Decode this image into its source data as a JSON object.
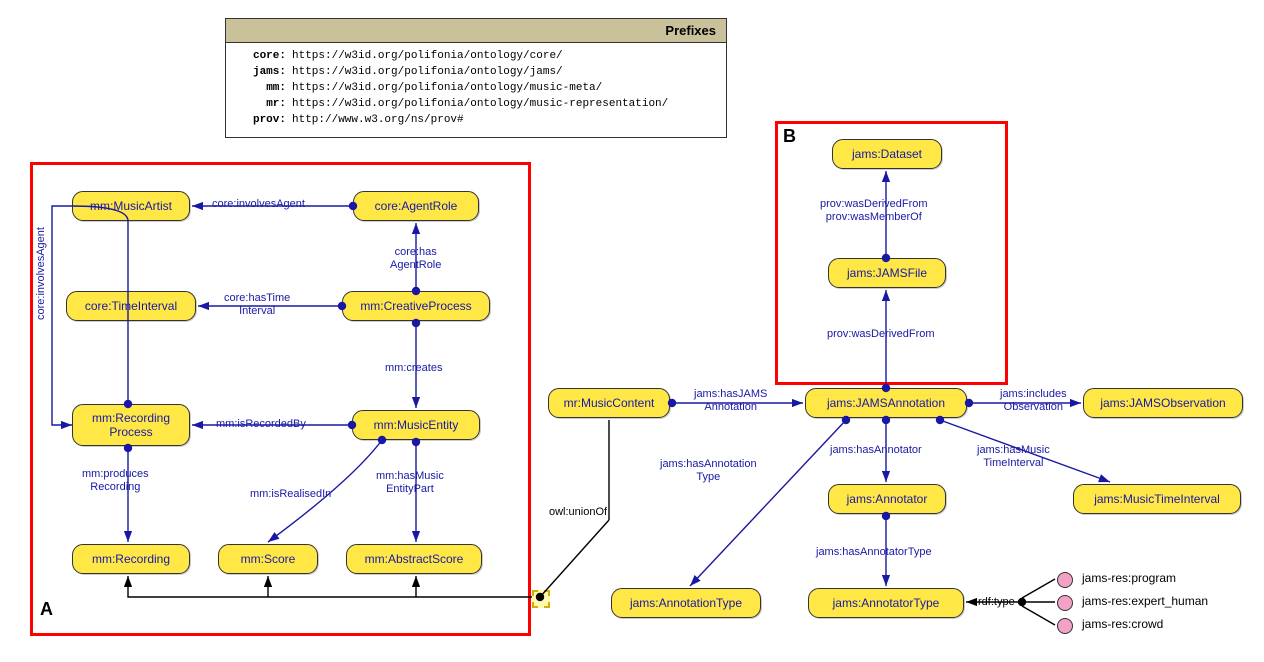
{
  "prefixes": {
    "title": "Prefixes",
    "rows": [
      {
        "key": "core:",
        "url": "https://w3id.org/polifonia/ontology/core/"
      },
      {
        "key": "jams:",
        "url": "https://w3id.org/polifonia/ontology/jams/"
      },
      {
        "key": "mm:",
        "url": "https://w3id.org/polifonia/ontology/music-meta/"
      },
      {
        "key": "mr:",
        "url": "https://w3id.org/polifonia/ontology/music-representation/"
      },
      {
        "key": "prov:",
        "url": "http://www.w3.org/ns/prov#"
      }
    ]
  },
  "regions": {
    "A": "A",
    "B": "B"
  },
  "nodes": {
    "musicArtist": "mm:MusicArtist",
    "agentRole": "core:AgentRole",
    "timeInterval": "core:TimeInterval",
    "creativeProcess": "mm:CreativeProcess",
    "recordingProcess": "mm:Recording\nProcess",
    "musicEntity": "mm:MusicEntity",
    "recording": "mm:Recording",
    "score": "mm:Score",
    "abstractScore": "mm:AbstractScore",
    "musicContent": "mr:MusicContent",
    "dataset": "jams:Dataset",
    "jamsFile": "jams:JAMSFile",
    "jamsAnnotation": "jams:JAMSAnnotation",
    "jamsObservation": "jams:JAMSObservation",
    "annotationType": "jams:AnnotationType",
    "annotator": "jams:Annotator",
    "annotatorType": "jams:AnnotatorType",
    "musicTimeInterval": "jams:MusicTimeInterval"
  },
  "individuals": {
    "program": "jams-res:program",
    "expertHuman": "jams-res:expert_human",
    "crowd": "jams-res:crowd"
  },
  "edges": {
    "involvesAgent1": "core:involvesAgent",
    "hasAgentRole": "core:has\nAgentRole",
    "hasTimeInterval": "core:hasTime\nInterval",
    "creates": "mm:creates",
    "isRecordedBy": "mm:isRecordedBy",
    "involvesAgent2": "core:involvesAgent",
    "producesRecording": "mm:produces\nRecording",
    "isRealisedIn": "mm:isRealisedIn",
    "hasMusicEntityPart": "mm:hasMusic\nEntityPart",
    "unionOf": "owl:unionOf",
    "hasJAMSAnnotation": "jams:hasJAMS\nAnnotation",
    "wasDerivedFrom1": "prov:wasDerivedFrom\nprov:wasMemberOf",
    "wasDerivedFrom2": "prov:wasDerivedFrom",
    "includesObservation": "jams:includes\nObservation",
    "hasAnnotationType": "jams:hasAnnotation\nType",
    "hasAnnotator": "jams:hasAnnotator",
    "hasMusicTimeInterval": "jams:hasMusic\nTimeInterval",
    "hasAnnotatorType": "jams:hasAnnotatorType",
    "rdfType": "rdf:type"
  }
}
